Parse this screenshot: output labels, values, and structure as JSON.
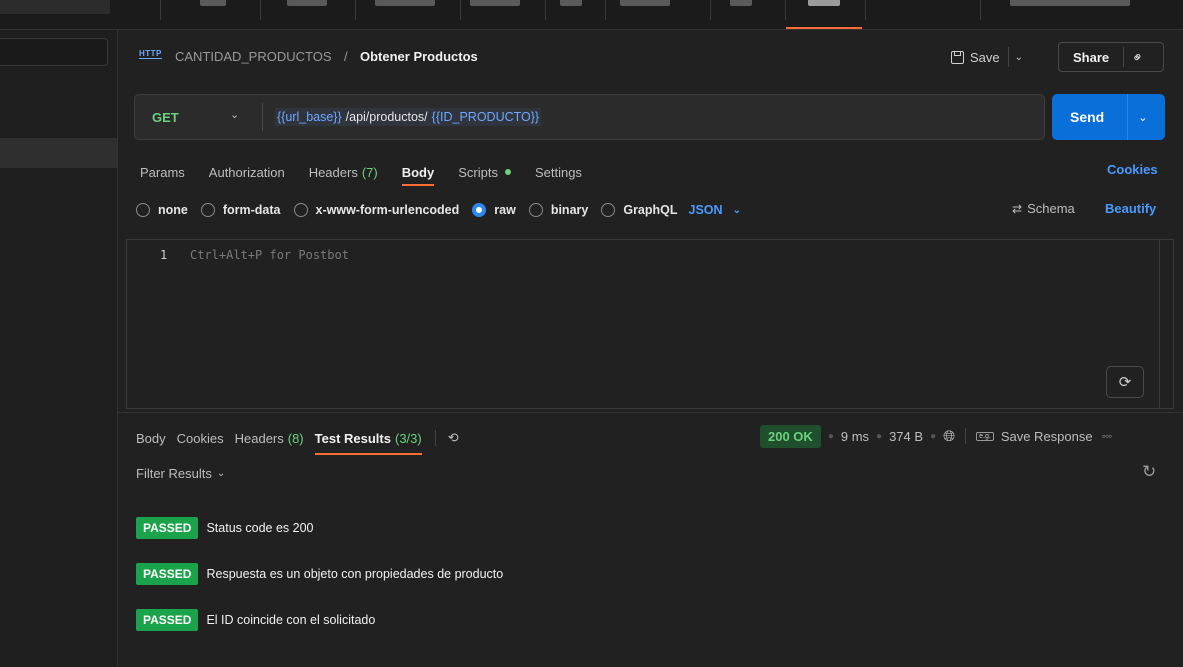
{
  "breadcrumb": {
    "icon": "HTTP",
    "collection": "CANTIDAD_PRODUCTOS",
    "separator": "/",
    "request": "Obtener Productos"
  },
  "toolbar": {
    "save_label": "Save",
    "share_label": "Share"
  },
  "request": {
    "method": "GET",
    "url_parts": [
      "{{url_base}}",
      "/api/productos/",
      "{{ID_PRODUCTO}}"
    ],
    "send_label": "Send"
  },
  "request_tabs": [
    {
      "label": "Params"
    },
    {
      "label": "Authorization"
    },
    {
      "label": "Headers",
      "count": "(7)"
    },
    {
      "label": "Body",
      "active": true
    },
    {
      "label": "Scripts",
      "dot": true
    },
    {
      "label": "Settings"
    }
  ],
  "cookies_label": "Cookies",
  "body_modes": [
    "none",
    "form-data",
    "x-www-form-urlencoded",
    "raw",
    "binary",
    "GraphQL"
  ],
  "body_mode_selected": "raw",
  "body_format": "JSON",
  "schema_label": "Schema",
  "beautify_label": "Beautify",
  "editor": {
    "line_number": "1",
    "placeholder": "Ctrl+Alt+P for Postbot"
  },
  "response_tabs": [
    {
      "label": "Body"
    },
    {
      "label": "Cookies"
    },
    {
      "label": "Headers",
      "count": "(8)"
    },
    {
      "label": "Test Results",
      "count": "(3/3)",
      "active": true
    }
  ],
  "response_status": {
    "code": "200 OK",
    "time": "9 ms",
    "size": "374 B",
    "save_response": "Save Response"
  },
  "filter_label": "Filter Results",
  "test_results": [
    {
      "status": "PASSED",
      "name": "Status code es 200"
    },
    {
      "status": "PASSED",
      "name": "Respuesta es un objeto con propiedades de producto"
    },
    {
      "status": "PASSED",
      "name": "El ID coincide con el solicitado"
    }
  ],
  "colors": {
    "accent": "#ff6c37",
    "send": "#0a6fd8",
    "passed": "#1aa34a",
    "method_get": "#6bd17f",
    "link": "#4a9bff"
  }
}
